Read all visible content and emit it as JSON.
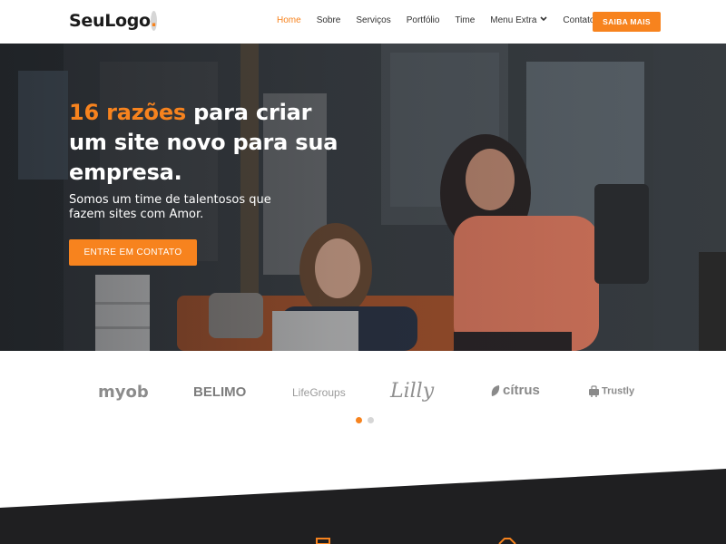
{
  "header": {
    "logo_text": "SeuLogo",
    "logo_dot": ".",
    "nav": [
      {
        "label": "Home",
        "active": true
      },
      {
        "label": "Sobre",
        "active": false
      },
      {
        "label": "Serviços",
        "active": false
      },
      {
        "label": "Portfólio",
        "active": false
      },
      {
        "label": "Time",
        "active": false
      },
      {
        "label": "Menu Extra",
        "active": false,
        "has_dropdown": true
      },
      {
        "label": "Contato",
        "active": false
      }
    ],
    "cta_label": "SAIBA MAIS",
    "dropdown_icon": "chevron-down-icon"
  },
  "hero": {
    "title_accent": "16 razões",
    "title_rest": " para criar um site novo para sua empresa.",
    "subtitle": "Somos um time de talentosos que fazem sites com Amor.",
    "cta_label": "ENTRE EM CONTATO"
  },
  "clients": {
    "logos": [
      {
        "name": "myob",
        "icon": "myob-logo"
      },
      {
        "name": "BELIMO",
        "icon": "belimo-logo"
      },
      {
        "name": "LifeGroups",
        "icon": "lifegroups-logo"
      },
      {
        "name": "Lilly",
        "icon": "lilly-logo"
      },
      {
        "name": "cítrus",
        "icon": "citrus-logo"
      },
      {
        "name": "Trustly",
        "icon": "trustly-logo"
      }
    ],
    "carousel_dots": 2,
    "active_dot": 0
  },
  "colors": {
    "accent": "#f7831e",
    "dark": "#1f1f21",
    "text": "#333333"
  }
}
